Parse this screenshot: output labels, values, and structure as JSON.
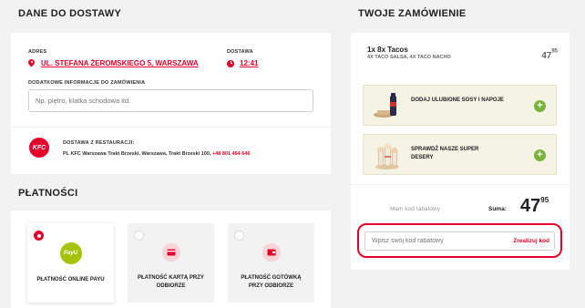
{
  "delivery": {
    "title": "DANE DO DOSTAWY",
    "address_label": "ADRES",
    "address": "UL. STEFANA ŻEROMSKIEGO 5, WARSZAWA",
    "time_label": "DOSTAWA",
    "time": "12:41",
    "extra_label": "DODATKOWE INFORMACJE DO ZAMÓWIENIA",
    "extra_placeholder": "Np. piętro, klatka schodowa itd.",
    "restaurant_label": "DOSTAWA Z RESTAURACJI:",
    "restaurant_name": "PL KFC Warszawa Trakt Brzeski, Warszawa, Trakt Brzeski 100,",
    "restaurant_phone": "+48 801 464 646",
    "logo_text": "KFC"
  },
  "payments": {
    "title": "PŁATNOŚCI",
    "options": [
      {
        "label": "PŁATNOŚĆ ONLINE PAYU",
        "icon_text": "PayU",
        "selected": true
      },
      {
        "label": "PŁATNOŚĆ KARTĄ PRZY ODBIORZE",
        "selected": false
      },
      {
        "label": "PŁATNOŚĆ GOTÓWKĄ PRZY ODBIORZE",
        "selected": false
      }
    ]
  },
  "order": {
    "title": "TWOJE ZAMÓWIENIE",
    "item_name": "1x 8x Tacos",
    "item_desc": "4X TACO SALSA, 4X TACO NACHO",
    "item_price_main": "47",
    "item_price_cents": "95",
    "upsells": [
      {
        "label": "DODAJ ULUBIONE SOSY I NAPOJE"
      },
      {
        "label": "SPRAWDŹ NASZE SUPER DESERY"
      }
    ],
    "coupon_toggle": "Mam kod rabatowy",
    "sum_label": "Suma:",
    "sum_main": "47",
    "sum_cents": "95",
    "coupon_placeholder": "Wpisz swój kod rabatowy",
    "coupon_button": "Zrealizuj kod"
  },
  "colors": {
    "accent": "#e4002b",
    "upsell_add": "#7ab339",
    "payu": "#a6c307"
  }
}
